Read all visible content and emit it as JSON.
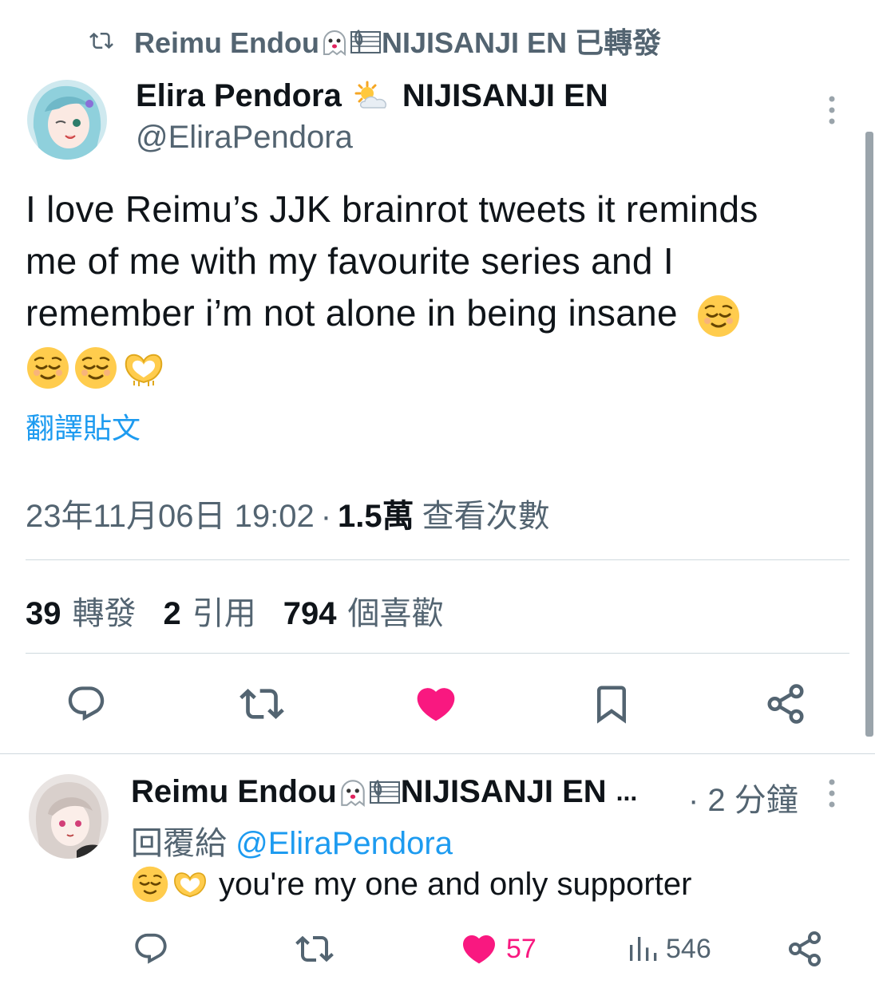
{
  "retweet_header": {
    "name": "Reimu Endou",
    "org": "NIJISANJI EN",
    "action": "已轉發"
  },
  "author": {
    "name": "Elira Pendora",
    "org": "NIJISANJI EN",
    "handle": "@EliraPendora"
  },
  "tweet": {
    "line1": "I love Reimu’s JJK brainrot tweets it reminds",
    "line2": "me of me with my favourite series and I",
    "line3": "remember i’m not alone in being insane",
    "emojis": [
      "relieved-face",
      "relieved-face",
      "relieved-face",
      "heart-hands"
    ],
    "translate_label": "翻譯貼文"
  },
  "meta": {
    "timestamp": "23年11月06日 19:02",
    "separator": "·",
    "views_count": "1.5萬",
    "views_label": "查看次數"
  },
  "stats": {
    "retweets": "39",
    "retweets_label": "轉發",
    "quotes": "2",
    "quotes_label": "引用",
    "likes": "794",
    "likes_label": "個喜歡"
  },
  "actions": [
    "reply-icon",
    "retweet-icon",
    "like-icon",
    "bookmark-icon",
    "share-icon"
  ],
  "reply": {
    "name": "Reimu Endou",
    "org": "NIJISANJI EN",
    "ellipsis": "...",
    "time": "· 2 分鐘",
    "replying_prefix": "回覆給",
    "replying_handle": "@EliraPendora",
    "text": "you're my one and only supporter",
    "likes": "57",
    "views": "546"
  },
  "colors": {
    "text": "#0f1419",
    "muted": "#536471",
    "link": "#1d9bf0",
    "like": "#f91880",
    "divider": "#cfd9de"
  }
}
